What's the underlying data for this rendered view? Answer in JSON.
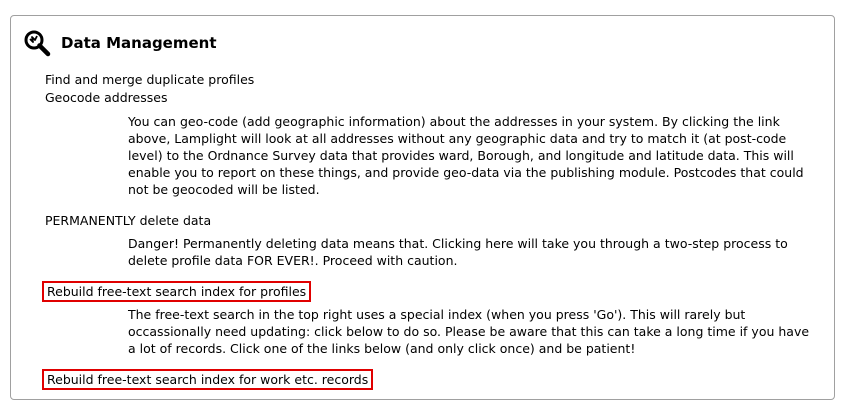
{
  "panel": {
    "title": "Data Management",
    "icon": "magnifier-icon"
  },
  "items": [
    {
      "label": "Find and merge duplicate profiles"
    },
    {
      "label": "Geocode addresses",
      "description": "You can geo-code (add geographic information) about the addresses in your system. By clicking the link above, Lamplight will look at all addresses without any geographic data and try to match it (at post-code level) to the Ordnance Survey data that provides ward, Borough, and longitude and latitude data. This will enable you to report on these things, and provide geo-data via the publishing module. Postcodes that could not be geocoded will be listed."
    },
    {
      "label": "PERMANENTLY delete data",
      "description": "Danger! Permanently deleting data means that. Clicking here will take you through a two-step process to delete profile data FOR EVER!. Proceed with caution."
    },
    {
      "label": "Rebuild free-text search index for profiles",
      "description": "The free-text search in the top right uses a special index (when you press 'Go'). This will rarely but occassionally need updating: click below to do so. Please be aware that this can take a long time if you have a lot of records. Click one of the links below (and only click once) and be patient!"
    },
    {
      "label": "Rebuild free-text search index for work etc. records"
    }
  ],
  "colors": {
    "highlight": "#e00000",
    "border": "#a0a0a0"
  }
}
